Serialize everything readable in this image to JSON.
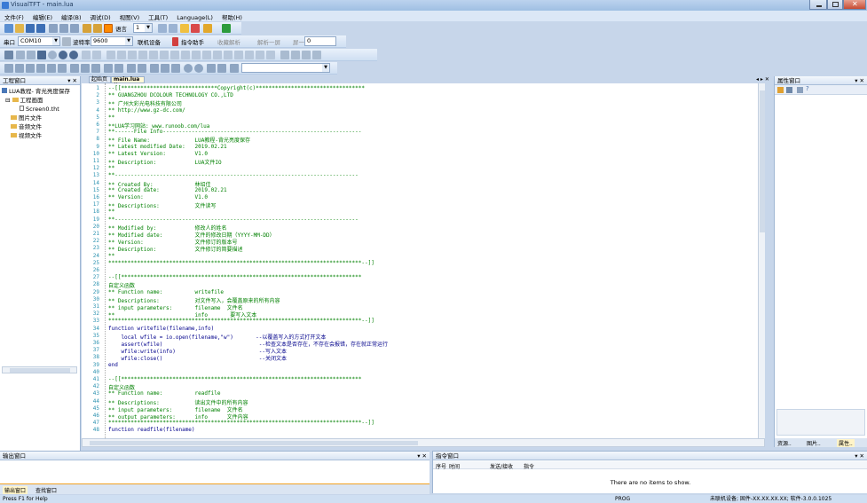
{
  "window": {
    "title": "VisualTFT - main.lua"
  },
  "menu": [
    "文件(F)",
    "编辑(E)",
    "编译(B)",
    "调试(D)",
    "视图(V)",
    "工具(T)",
    "Language(L)",
    "帮助(H)"
  ],
  "toolbar": {
    "lang_label": "语言",
    "lang_value": "1",
    "port_label": "串口",
    "port_value": "COM10",
    "baud_label": "波特率",
    "baud_value": "9600",
    "connect_label": "联机设备",
    "cmd_helper_label": "指令助手",
    "fav_label": "收藏解析",
    "last_label": "解析一屏",
    "screen_label": "屏一",
    "screen_value": "0"
  },
  "project_panel": {
    "title": "工程窗口",
    "items": [
      "LUA教程- 背光亮度保存",
      "工程画面",
      "Screen0.tht",
      "图片文件",
      "音频文件",
      "视频文件"
    ]
  },
  "tabs": {
    "start": "起始页",
    "main": "main.lua"
  },
  "code_lines": [
    "--[[******************************Copyright(c)**********************************",
    "** GUANGZHOU DCOLOUR TECHNOLOGY CO.,LTD",
    "** 广州大彩光电科技有限公司",
    "** http://www.gz-dc.com/",
    "**",
    "**LUA学习网站: www.runoob.com/lua",
    "**------File Info--------------------------------------------------------------",
    "** File Name:              LUA教程-背光亮度保存",
    "** Latest modified Date:   2019.02.21",
    "** Latest Version:         V1.0",
    "** Description:            LUA文件IO",
    "**",
    "**----------------------------------------------------------------------------",
    "** Created By:             林绍佳",
    "** Created date:           2019.02.21",
    "** Version:                V1.0",
    "** Descriptions:           文件读写",
    "**",
    "**----------------------------------------------------------------------------",
    "** Modified by:            修改人的姓名",
    "** Modified date:          文件的修改日期（YYYY-MM-DD）",
    "** Version:                文件修订的版本号",
    "** Description:            文件修订的简要描述",
    "**",
    "*******************************************************************************--]]",
    "",
    "--[[***************************************************************************",
    "自定义函数",
    "** Function name:          writefile",
    "** Descriptions:           对文件写入，会覆盖原来的所有内容",
    "** input parameters:       filename  文件名",
    "**                         info       要写入文本",
    "*******************************************************************************--]]",
    "function writefile(filename,info)",
    "    local wfile = io.open(filename,\"w\")       --以覆盖写入的方式打开文本",
    "    assert(wfile)                              --检查文本是否存在，不存在会报错，存在就正常运行",
    "    wfile:write(info)                          --写入文本",
    "    wfile:close()                              --关闭文本",
    "end",
    "",
    "--[[***************************************************************************",
    "自定义函数",
    "** Function name:          readfile",
    "** Descriptions:           读出文件中的所有内容",
    "** input parameters:       filename  文件名",
    "** output parameters:      info      文件内容",
    "*******************************************************************************--]]",
    "function readfile(filename)"
  ],
  "props_panel": {
    "title": "属性窗口"
  },
  "right_tabs": [
    "资源..",
    "图片..",
    "属性.."
  ],
  "output_panel": {
    "title": "输出窗口",
    "tab_output": "输出窗口",
    "tab_find": "查找窗口"
  },
  "cmd_panel": {
    "title": "指令窗口",
    "columns": [
      "序号",
      "时间",
      "发送/接收",
      "指令"
    ],
    "empty": "There are no items to show."
  },
  "status": {
    "left": "Press F1 for Help",
    "mode": "PROG",
    "right": "未联机设备; 固件-XX.XX.XX.XX; 软件-3.0.0.1025"
  }
}
